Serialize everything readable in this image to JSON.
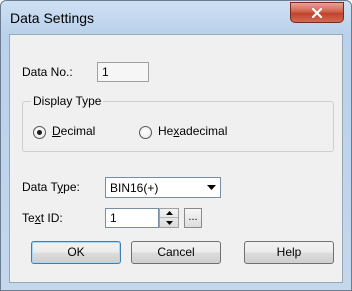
{
  "window": {
    "title": "Data Settings",
    "close_glyph": "X"
  },
  "data_no": {
    "label": "Data No.:",
    "value": "1"
  },
  "display_type": {
    "legend": "Display Type",
    "options": [
      {
        "pre": "",
        "u": "D",
        "post": "ecimal",
        "selected": true
      },
      {
        "pre": "He",
        "u": "x",
        "post": "adecimal",
        "selected": false
      }
    ]
  },
  "data_type": {
    "label_pre": "Data T",
    "label_u": "y",
    "label_post": "pe:",
    "value": "BIN16(+)"
  },
  "text_id": {
    "label_pre": "Te",
    "label_u": "x",
    "label_post": "t ID:",
    "value": "1",
    "browse_label": "..."
  },
  "buttons": {
    "ok": "OK",
    "cancel": "Cancel",
    "help": "Help"
  },
  "icons": {
    "close": "close-icon",
    "dropdown": "chevron-down-icon",
    "spin_up": "spin-up-icon",
    "spin_down": "spin-down-icon"
  }
}
